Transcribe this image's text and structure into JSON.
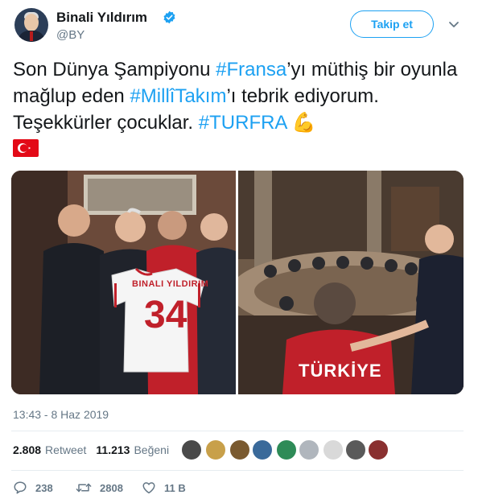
{
  "author": {
    "name": "Binali Yıldırım",
    "handle": "@BY"
  },
  "follow_button": {
    "label": "Takip et"
  },
  "tweet": {
    "part1": "Son Dünya Şampiyonu ",
    "tag1": "#Fransa",
    "part2": "’yı müthiş bir oyunla mağlup eden ",
    "tag2": "#MillîTakım",
    "part3": "’ı tebrik ediyorum. Teşekkürler çocuklar. ",
    "tag3": "#TURFRA",
    "emoji": "💪"
  },
  "jersey": {
    "name": "BINALI YILDIRIM",
    "number": "34"
  },
  "shirt_back_text": "TÜRKİYE",
  "timestamp": "13:43 - 8 Haz 2019",
  "stats": {
    "retweets_count": "2.808",
    "retweets_label": "Retweet",
    "likes_count": "11.213",
    "likes_label": "Beğeni"
  },
  "actions": {
    "replies": "238",
    "retweets": "2808",
    "likes": "11 B"
  },
  "colors": {
    "accent": "#1da1f2",
    "text": "#14171a",
    "muted": "#657786",
    "flag_red": "#e30a17"
  }
}
